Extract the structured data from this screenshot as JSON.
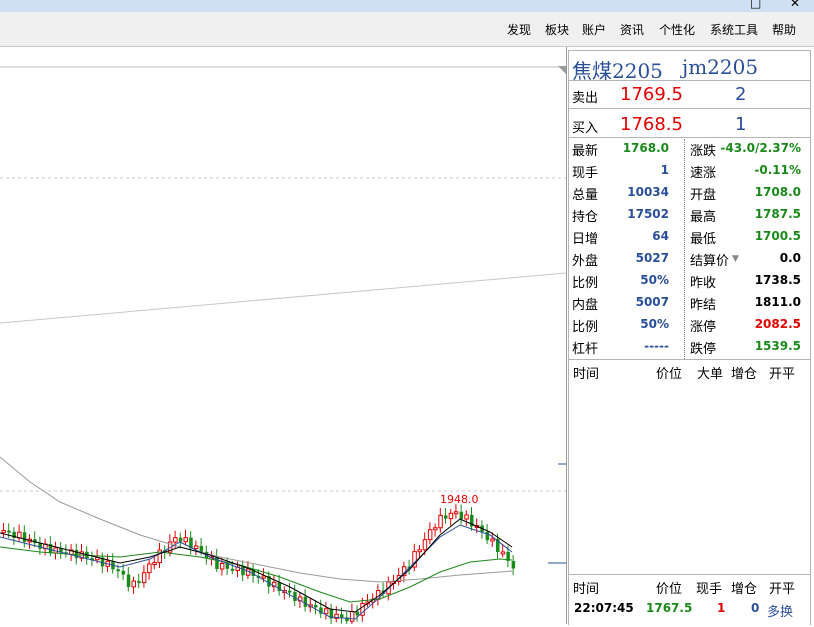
{
  "menu": [
    "发现",
    "板块",
    "账户",
    "资讯",
    "个性化",
    "系统工具",
    "帮助"
  ],
  "symbol": {
    "name": "焦煤2205",
    "code": "jm2205"
  },
  "quote": {
    "ask_label": "卖出",
    "ask_price": "1769.5",
    "ask_vol": "2",
    "bid_label": "买入",
    "bid_price": "1768.5",
    "bid_vol": "1"
  },
  "stats_left": [
    {
      "label": "最新",
      "value": "1768.0",
      "color": "#1a8a1a"
    },
    {
      "label": "现手",
      "value": "1",
      "color": "#2a4f9a"
    },
    {
      "label": "总量",
      "value": "10034",
      "color": "#2a4f9a"
    },
    {
      "label": "持仓",
      "value": "17502",
      "color": "#2a4f9a"
    },
    {
      "label": "日增",
      "value": "64",
      "color": "#2a4f9a"
    },
    {
      "label": "外盘",
      "value": "5027",
      "color": "#2a4f9a"
    },
    {
      "label": "比例",
      "value": "50%",
      "color": "#2a4f9a"
    },
    {
      "label": "内盘",
      "value": "5007",
      "color": "#2a4f9a"
    },
    {
      "label": "比例",
      "value": "50%",
      "color": "#2a4f9a"
    },
    {
      "label": "杠杆",
      "value": "-----",
      "color": "#2a4f9a"
    }
  ],
  "stats_right": [
    {
      "label": "涨跌",
      "value": "-43.0/2.37%",
      "color": "#1a8a1a"
    },
    {
      "label": "速涨",
      "value": "-0.11%",
      "color": "#1a8a1a"
    },
    {
      "label": "开盘",
      "value": "1708.0",
      "color": "#1a8a1a"
    },
    {
      "label": "最高",
      "value": "1787.5",
      "color": "#1a8a1a"
    },
    {
      "label": "最低",
      "value": "1700.5",
      "color": "#1a8a1a"
    },
    {
      "label": "结算价",
      "value": "0.0",
      "color": "#000000"
    },
    {
      "label": "昨收",
      "value": "1738.5",
      "color": "#000000"
    },
    {
      "label": "昨结",
      "value": "1811.0",
      "color": "#000000"
    },
    {
      "label": "涨停",
      "value": "2082.5",
      "color": "#e60000"
    },
    {
      "label": "跌停",
      "value": "1539.5",
      "color": "#1a8a1a"
    }
  ],
  "tick_header": {
    "time": "时间",
    "price": "价位",
    "big": "大单",
    "oi": "增仓",
    "type": "开平"
  },
  "trade_header": {
    "time": "时间",
    "price": "价位",
    "vol": "现手",
    "oi": "增仓",
    "type": "开平"
  },
  "trade_row": {
    "time": "22:07:45",
    "price": "1767.5",
    "vol": "1",
    "oi": "0",
    "type": "多换"
  },
  "chart": {
    "high_label": "1948.0",
    "up_color": "#e60000",
    "down_color": "#1a8a1a"
  }
}
